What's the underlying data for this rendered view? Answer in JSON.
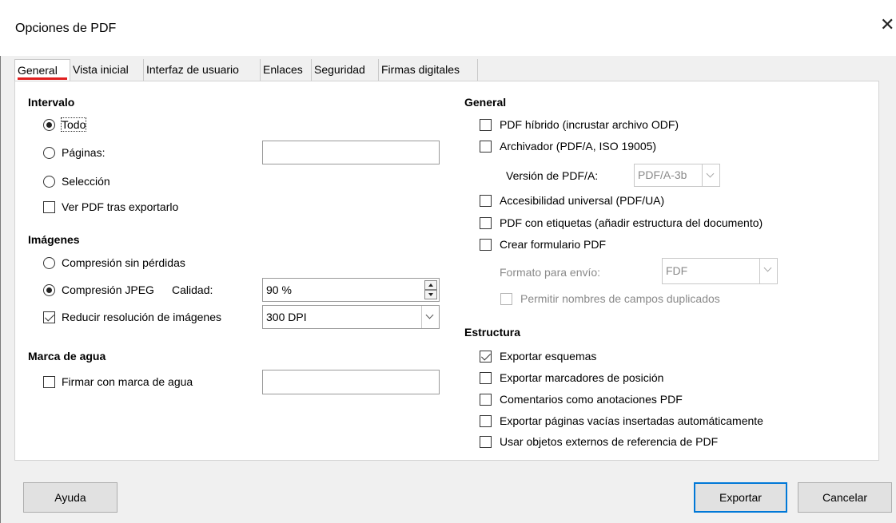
{
  "window": {
    "title": "Opciones de PDF",
    "close_symbol": "✕"
  },
  "tabs": [
    {
      "label": "General",
      "active": true
    },
    {
      "label": "Vista inicial"
    },
    {
      "label": "Interfaz de usuario"
    },
    {
      "label": "Enlaces"
    },
    {
      "label": "Seguridad"
    },
    {
      "label": "Firmas digitales"
    }
  ],
  "intervalo": {
    "heading": "Intervalo",
    "todo": {
      "label": "Todo",
      "selected": true
    },
    "paginas": {
      "label": "Páginas:",
      "selected": false,
      "value": ""
    },
    "seleccion": {
      "label": "Selección",
      "selected": false
    },
    "ver_pdf": {
      "label": "Ver PDF tras exportarlo",
      "checked": false
    }
  },
  "imagenes": {
    "heading": "Imágenes",
    "sin_perdidas": {
      "label": "Compresión sin pérdidas",
      "selected": false
    },
    "jpeg": {
      "label": "Compresión JPEG",
      "selected": true
    },
    "calidad_label": "Calidad:",
    "calidad_value": "90 %",
    "reducir": {
      "label": "Reducir resolución de imágenes",
      "checked": true
    },
    "dpi_value": "300 DPI"
  },
  "marca_agua": {
    "heading": "Marca de agua",
    "firmar": {
      "label": "Firmar con marca de agua",
      "checked": false
    },
    "value": ""
  },
  "general": {
    "heading": "General",
    "hibrido": {
      "label": "PDF híbrido (incrustar archivo ODF)",
      "checked": false
    },
    "archivador": {
      "label": "Archivador (PDF/A, ISO 19005)",
      "checked": false
    },
    "version_label": "Versión de PDF/A:",
    "version_value": "PDF/A-3b",
    "accesibilidad": {
      "label": "Accesibilidad universal (PDF/UA)",
      "checked": false
    },
    "etiquetas": {
      "label": "PDF con etiquetas (añadir estructura del documento)",
      "checked": false
    },
    "formulario": {
      "label": "Crear formulario PDF",
      "checked": false
    },
    "formato_label": "Formato para envío:",
    "formato_value": "FDF",
    "duplicados": {
      "label": "Permitir nombres de campos duplicados",
      "checked": false
    }
  },
  "estructura": {
    "heading": "Estructura",
    "esquemas": {
      "label": "Exportar esquemas",
      "checked": true
    },
    "marcadores": {
      "label": "Exportar marcadores de posición",
      "checked": false
    },
    "comentarios": {
      "label": "Comentarios como anotaciones PDF",
      "checked": false
    },
    "vacias": {
      "label": "Exportar páginas vacías insertadas automáticamente",
      "checked": false
    },
    "externos": {
      "label": "Usar objetos externos de referencia de PDF",
      "checked": false
    }
  },
  "buttons": {
    "ayuda": "Ayuda",
    "exportar": "Exportar",
    "cancelar": "Cancelar"
  },
  "colors": {
    "accent": "#0078d7",
    "tab_underline": "#e02020",
    "panel": "#ffffff",
    "background": "#f0f0f0"
  }
}
